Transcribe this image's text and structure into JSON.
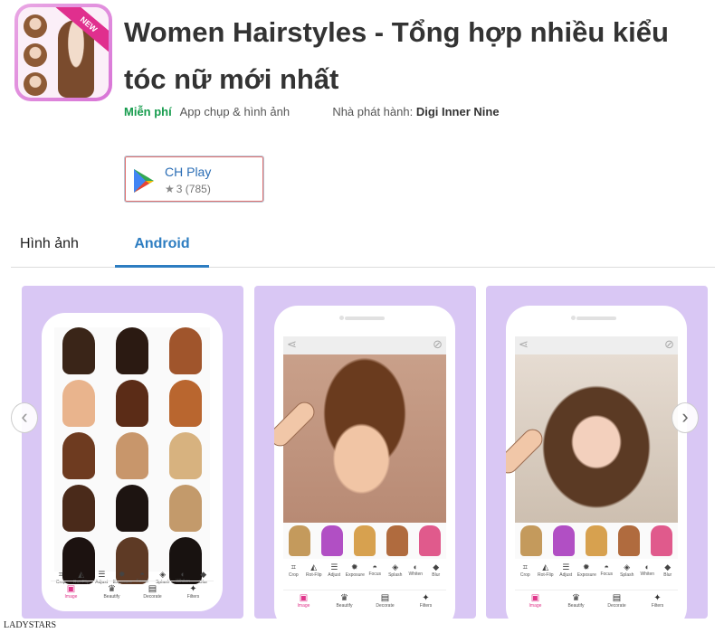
{
  "app": {
    "title": "Women Hairstyles - Tổng hợp nhiều kiểu tóc nữ mới nhất",
    "icon_badge": "NEW",
    "price": "Miễn phí",
    "category": "App chụp & hình ảnh",
    "publisher_label": "Nhà phát hành:",
    "publisher": "Digi Inner Nine"
  },
  "store": {
    "name": "CH Play",
    "icon": "google-play-icon",
    "rating": "3",
    "reviews": "(785)"
  },
  "tabs": [
    {
      "label": "Hình ảnh",
      "active": false
    },
    {
      "label": "Android",
      "active": true
    }
  ],
  "screenshots": {
    "tools": [
      "Crop",
      "Rot-Flip",
      "Adjust",
      "Exposure",
      "Focus",
      "Splash",
      "Whiten",
      "Blur"
    ],
    "nav": [
      "Image",
      "Beautify",
      "Decorate",
      "Filters"
    ]
  },
  "colors": {
    "accent_blue": "#2d7dc1",
    "free_green": "#169c4d",
    "screenshot_bg": "#d9c7f4",
    "active_pink": "#e0368b"
  },
  "watermark": "LADYSTARS"
}
